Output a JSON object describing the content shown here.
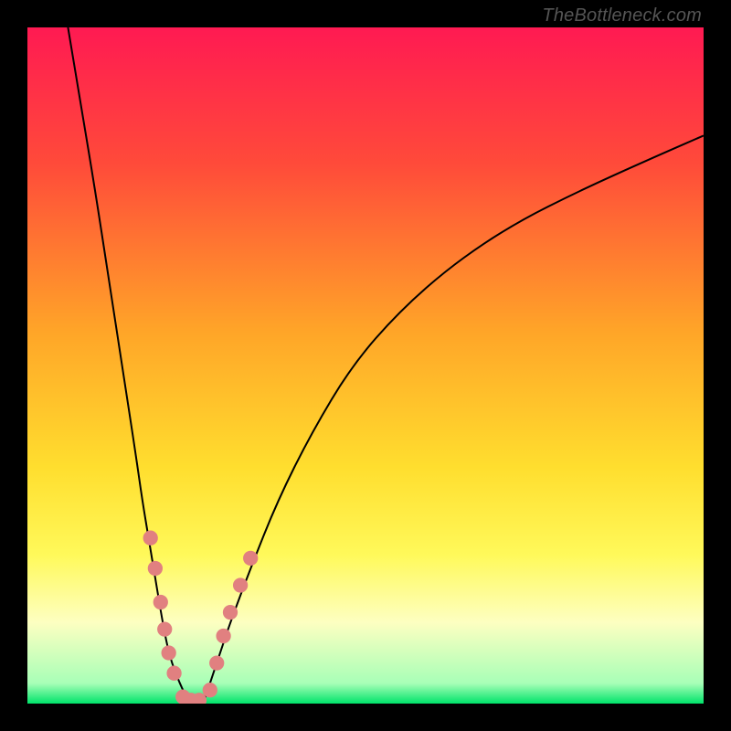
{
  "watermark": "TheBottleneck.com",
  "chart_data": {
    "type": "line",
    "title": "",
    "xlabel": "",
    "ylabel": "",
    "xlim": [
      0,
      100
    ],
    "ylim": [
      0,
      100
    ],
    "grid": false,
    "legend": false,
    "background": {
      "type": "vertical-gradient",
      "stops": [
        {
          "pos": 0.0,
          "color": "#ff1a52"
        },
        {
          "pos": 0.2,
          "color": "#ff4a3a"
        },
        {
          "pos": 0.45,
          "color": "#ffa528"
        },
        {
          "pos": 0.65,
          "color": "#ffde2e"
        },
        {
          "pos": 0.78,
          "color": "#fff95a"
        },
        {
          "pos": 0.88,
          "color": "#fdffc1"
        },
        {
          "pos": 0.97,
          "color": "#a8ffb7"
        },
        {
          "pos": 1.0,
          "color": "#00e36a"
        }
      ]
    },
    "series": [
      {
        "name": "left-branch",
        "color": "#000000",
        "x": [
          6,
          8,
          10,
          12,
          14,
          16,
          17,
          18,
          19,
          20,
          21,
          22.5,
          24
        ],
        "y": [
          100,
          88,
          76,
          63,
          50,
          37,
          30,
          24,
          18,
          12,
          7,
          3,
          0
        ]
      },
      {
        "name": "right-branch",
        "color": "#000000",
        "x": [
          26,
          27,
          28,
          30,
          33,
          37,
          42,
          48,
          55,
          63,
          72,
          82,
          92,
          100
        ],
        "y": [
          0,
          3,
          6,
          12,
          20,
          30,
          40,
          50,
          58,
          65,
          71,
          76,
          80.5,
          84
        ]
      }
    ],
    "markers": {
      "color": "#e18080",
      "radius_pct": 1.1,
      "points": [
        {
          "x": 18.2,
          "y": 24.5
        },
        {
          "x": 18.9,
          "y": 20.0
        },
        {
          "x": 19.7,
          "y": 15.0
        },
        {
          "x": 20.3,
          "y": 11.0
        },
        {
          "x": 20.9,
          "y": 7.5
        },
        {
          "x": 21.7,
          "y": 4.5
        },
        {
          "x": 23.0,
          "y": 1.0
        },
        {
          "x": 24.2,
          "y": 0.5
        },
        {
          "x": 25.4,
          "y": 0.5
        },
        {
          "x": 27.0,
          "y": 2.0
        },
        {
          "x": 28.0,
          "y": 6.0
        },
        {
          "x": 29.0,
          "y": 10.0
        },
        {
          "x": 30.0,
          "y": 13.5
        },
        {
          "x": 31.5,
          "y": 17.5
        },
        {
          "x": 33.0,
          "y": 21.5
        }
      ]
    }
  }
}
